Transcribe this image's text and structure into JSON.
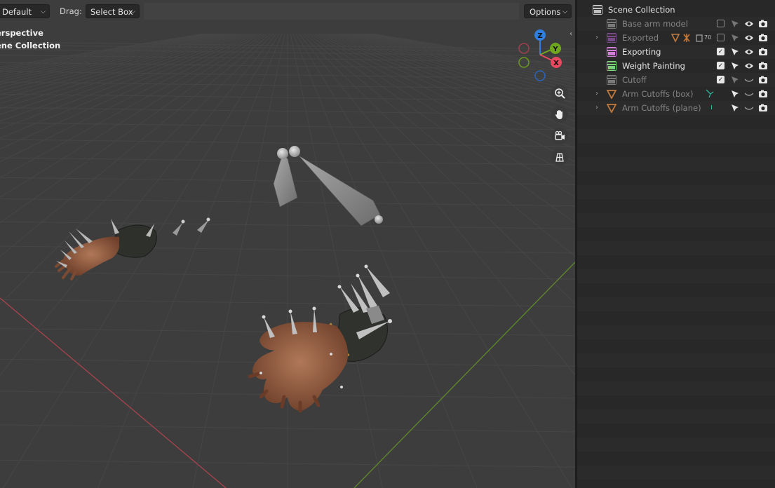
{
  "viewport": {
    "mode_dropdown": "Default",
    "drag_label": "Drag:",
    "drag_dropdown": "Select Box",
    "options_label": "Options",
    "view_name": "erspective",
    "collection_name": "ene Collection"
  },
  "gizmo": {
    "axes": [
      "Z",
      "Y",
      "X"
    ],
    "colors": {
      "x": "#e9495f",
      "y": "#70a71f",
      "z": "#2e7fdf"
    }
  },
  "nav_buttons": [
    "zoom-icon",
    "hand-icon",
    "camera-icon",
    "grid-icon"
  ],
  "outliner": {
    "root_label": "Scene Collection",
    "rows": [
      {
        "label": "Base arm model",
        "type": "collection",
        "icon_color": "#7a7a7a",
        "dim": true,
        "checked": false,
        "expandable": false
      },
      {
        "label": "Exported",
        "type": "collection",
        "icon_color": "#7a4b8a",
        "dim": true,
        "checked": false,
        "expandable": true,
        "badge": "70"
      },
      {
        "label": "Exporting",
        "type": "collection",
        "icon_color": "#d37fd8",
        "dim": false,
        "checked": true,
        "expandable": false
      },
      {
        "label": "Weight Painting",
        "type": "collection",
        "icon_color": "#7ad17a",
        "dim": false,
        "checked": true,
        "expandable": false
      },
      {
        "label": "Cutoff",
        "type": "collection",
        "icon_color": "#7a7a7a",
        "dim": true,
        "checked": true,
        "expandable": false
      },
      {
        "label": "Arm Cutoffs (box)",
        "type": "mesh",
        "icon_color": "#c47a3c",
        "dim": true,
        "expandable": true
      },
      {
        "label": "Arm Cutoffs (plane)",
        "type": "mesh",
        "icon_color": "#c47a3c",
        "dim": true,
        "expandable": true
      }
    ]
  }
}
